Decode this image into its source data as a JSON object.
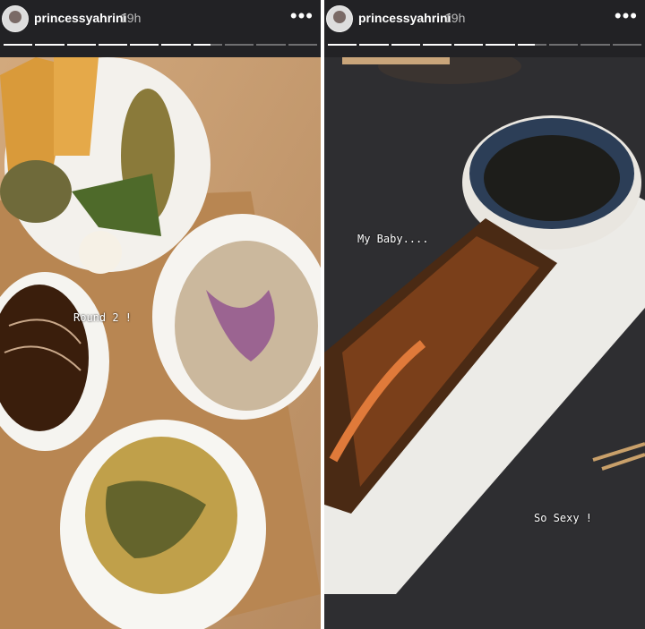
{
  "stories": [
    {
      "username": "princessyahrini",
      "time": "19h",
      "more_icon": "more-horizontal-icon",
      "progress": {
        "segments": 10,
        "viewed": 7
      },
      "caption": "Round 2 !"
    },
    {
      "username": "princessyahrini",
      "time": "19h",
      "more_icon": "more-horizontal-icon",
      "progress": {
        "segments": 10,
        "viewed": 7
      },
      "captions": [
        "My Baby....",
        "So Sexy !"
      ]
    }
  ],
  "colors": {
    "header_bg": "#222225",
    "text": "#ffffff"
  }
}
